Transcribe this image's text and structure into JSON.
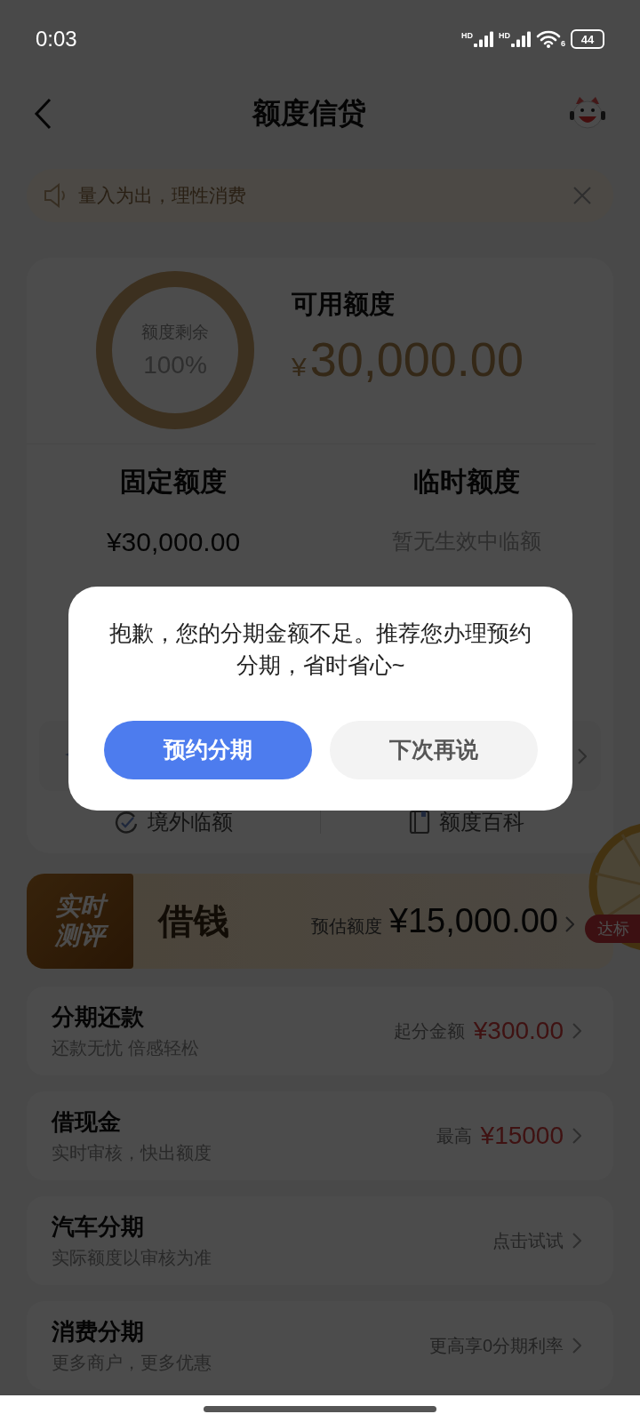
{
  "status_bar": {
    "time": "0:03",
    "signal_labels": [
      "HD",
      "HD"
    ],
    "wifi_label": "6",
    "battery": "44"
  },
  "header": {
    "title": "额度信贷"
  },
  "notice": {
    "text": "量入为出，理性消费"
  },
  "credit_card": {
    "ring_label": "额度剩余",
    "ring_value": "100%",
    "level": 1,
    "available_label": "可用额度",
    "currency": "¥",
    "available_amount": "30,000.00",
    "quotas": [
      {
        "label": "固定额度",
        "value": "¥30,000.00",
        "kind": "amount"
      },
      {
        "label": "临时额度",
        "value": "暂无生效中临额",
        "kind": "empty"
      }
    ],
    "links": [
      {
        "label": "境外临额"
      },
      {
        "label": "额度百科"
      }
    ]
  },
  "banner": {
    "tag": "实时测评",
    "title": "借钱",
    "estimate_label": "预估额度",
    "estimate_amount": "¥15,000.00"
  },
  "floating_badge": {
    "text": "达标"
  },
  "services": [
    {
      "title": "分期还款",
      "subtitle": "还款无忧 倍感轻松",
      "note": "起分金额",
      "amount": "¥300.00"
    },
    {
      "title": "借现金",
      "subtitle": "实时审核，快出额度",
      "note": "最高",
      "amount": "¥15000"
    },
    {
      "title": "汽车分期",
      "subtitle": "实际额度以审核为准",
      "note": "点击试试"
    },
    {
      "title": "消费分期",
      "subtitle": "更多商户，更多优惠",
      "note": "更高享0分期利率"
    }
  ],
  "dialog": {
    "message": "抱歉，您的分期金额不足。推荐您办理预约分期，省时省心~",
    "buttons": [
      {
        "label": "预约分期",
        "kind": "primary"
      },
      {
        "label": "下次再说",
        "kind": "secondary"
      }
    ]
  }
}
